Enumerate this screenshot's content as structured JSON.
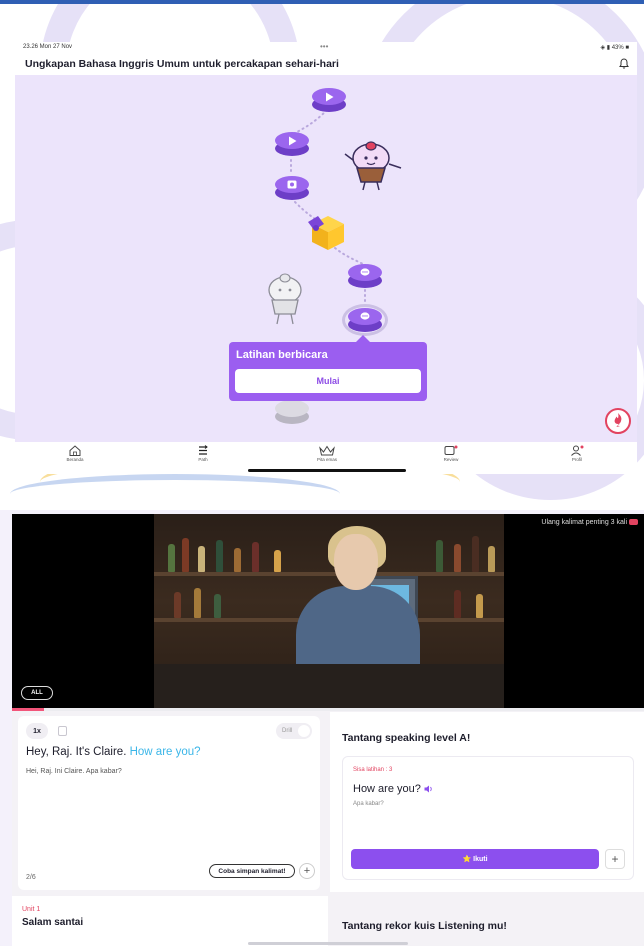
{
  "tablet_app": {
    "status_bar": {
      "time": "23.26  Mon 27 Nov",
      "dots": "•••",
      "right": "◈ ▮ 43% ■"
    },
    "header": {
      "title": "Ungkapan Bahasa Inggris Umum untuk percakapan sehari-hari",
      "chevron": "⌄"
    },
    "popup": {
      "title": "Latihan berbicara",
      "button": "Mulai"
    },
    "streak": {
      "count": "2"
    },
    "nav": [
      {
        "label": "Beranda",
        "icon": "home-icon"
      },
      {
        "label": "Path",
        "icon": "path-icon"
      },
      {
        "label": "Pita emas",
        "icon": "crown-icon"
      },
      {
        "label": "Review",
        "icon": "review-icon"
      },
      {
        "label": "Profil",
        "icon": "profile-icon"
      }
    ],
    "accent": "#9b5ef0"
  },
  "video_lesson": {
    "video": {
      "caption": "Ulang kalimat penting 3 kali",
      "all_label": "ALL",
      "progress": 0.05
    },
    "sentence_card": {
      "speed": "1x",
      "drill": "Drill",
      "en_prefix": "Hey, Raj. It's Claire. ",
      "en_highlight": "How are you?",
      "id": "Hei, Raj. Ini Claire. Apa kabar?",
      "count": "2/6",
      "save_label": "Coba simpan kalimat!",
      "plus": "+"
    },
    "unit": {
      "number": "Unit 1",
      "title": "Salam santai"
    },
    "challenge": {
      "title": "Tantang speaking level A!",
      "remaining": "Sisa latihan : 3",
      "phrase": "How are you?",
      "translation": "Apa kabar?",
      "button": "⭐ Ikuti",
      "plus": "+"
    },
    "listening": {
      "title": "Tantang rekor kuis Listening mu!"
    },
    "accent": "#8c4fee",
    "highlight": "#3bb6e8"
  }
}
